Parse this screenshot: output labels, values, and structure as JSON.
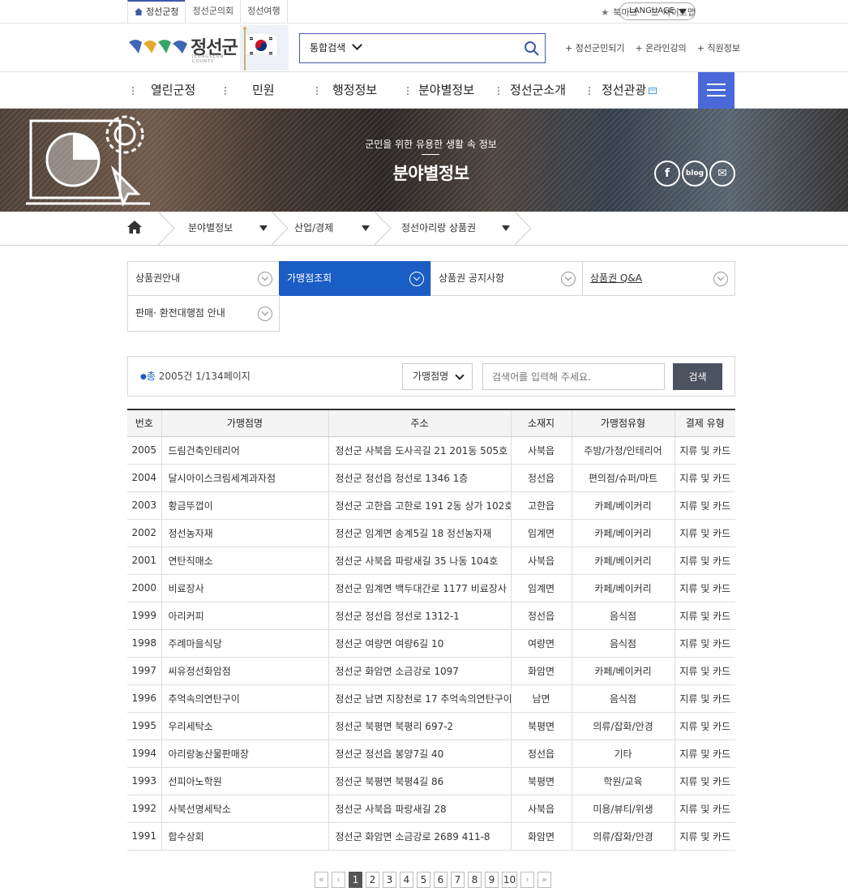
{
  "util": {
    "tabs": [
      "정선군청",
      "정선군의회",
      "정선여행"
    ],
    "bookmark": "북마크",
    "sitemap": "사이트맵",
    "language": "LANGUAGE"
  },
  "header": {
    "logo_text": "정선군",
    "logo_sub": "JEONGSEON COUNTY",
    "search_scope": "통합검색",
    "links": [
      "+ 정선군민되기",
      "+ 온라인강의",
      "+ 직원정보"
    ]
  },
  "gnb": [
    "열린군정",
    "민원",
    "행정정보",
    "분야별정보",
    "정선군소개",
    "정선관광"
  ],
  "banner": {
    "subtitle": "군민을 위한 유용한 생활 속 정보",
    "title": "분야별정보",
    "sns": [
      "f",
      "blog",
      "✉"
    ]
  },
  "location": [
    "분야별정보",
    "산업/경제",
    "정선아리랑 상품권"
  ],
  "subtabs": [
    "상품권안내",
    "가맹점조회",
    "상품권 공지사항",
    "상품권 Q&A",
    "판매· 환전대행점 안내"
  ],
  "search": {
    "count_prefix": "총",
    "count_text": " 2005건 1/134페이지",
    "select_value": "가맹점명",
    "placeholder": "검색어를 입력해 주세요.",
    "button": "검색"
  },
  "table": {
    "headers": [
      "번호",
      "가맹점명",
      "주소",
      "소재지",
      "가맹점유형",
      "결제 유형"
    ],
    "rows": [
      [
        "2005",
        "드림건축인테리어",
        "정선군 사북읍 도사곡길 21 201동 505호",
        "사북읍",
        "주방/가정/인테리어",
        "지류 및 카드"
      ],
      [
        "2004",
        "달시아이스크림세계과자점",
        "정선군 정선읍 정선로 1346 1층",
        "정선읍",
        "편의점/슈퍼/마트",
        "지류 및 카드"
      ],
      [
        "2003",
        "황금뚜껍이",
        "정선군 고한읍 고한로 191 2동 상가 102호",
        "고한읍",
        "카페/베이커리",
        "지류 및 카드"
      ],
      [
        "2002",
        "정선농자재",
        "정선군 임계면 송계5길 18 정선농자재",
        "임계면",
        "카페/베이커리",
        "지류 및 카드"
      ],
      [
        "2001",
        "연탄직매소",
        "정선군 사북읍 파랑새길 35 나동 104호",
        "사북읍",
        "카페/베이커리",
        "지류 및 카드"
      ],
      [
        "2000",
        "비료장사",
        "정선군 임계면 백두대간로 1177 비료장사",
        "임계면",
        "카페/베이커리",
        "지류 및 카드"
      ],
      [
        "1999",
        "아리커피",
        "정선군 정선읍 정선로 1312-1",
        "정선읍",
        "음식점",
        "지류 및 카드"
      ],
      [
        "1998",
        "주례마을식당",
        "정선군 여량면 여량6길 10",
        "여량면",
        "음식점",
        "지류 및 카드"
      ],
      [
        "1997",
        "씨유정선화암점",
        "정선군 화암면 소금강로 1097",
        "화암면",
        "카페/베이커리",
        "지류 및 카드"
      ],
      [
        "1996",
        "추억속의연탄구이",
        "정선군 남면 지장천로 17 추억속의연탄구이",
        "남면",
        "음식점",
        "지류 및 카드"
      ],
      [
        "1995",
        "우리세탁소",
        "정선군 북평면 북평리 697-2",
        "북평면",
        "의류/잡화/안경",
        "지류 및 카드"
      ],
      [
        "1994",
        "아리랑농산물판매장",
        "정선군 정선읍 봉양7길 40",
        "정선읍",
        "기타",
        "지류 및 카드"
      ],
      [
        "1993",
        "선피아노학원",
        "정선군 북평면 북평4길 86",
        "북평면",
        "학원/교육",
        "지류 및 카드"
      ],
      [
        "1992",
        "사북선명세탁소",
        "정선군 사북읍 파랑새길 28",
        "사북읍",
        "미용/뷰티/위생",
        "지류 및 카드"
      ],
      [
        "1991",
        "합수상회",
        "정선군 화암면 소금강로 2689 411-8",
        "화암면",
        "의류/잡화/안경",
        "지류 및 카드"
      ]
    ]
  },
  "pager": {
    "first": "«",
    "prev": "‹",
    "pages": [
      "1",
      "2",
      "3",
      "4",
      "5",
      "6",
      "7",
      "8",
      "9",
      "10"
    ],
    "current": "1",
    "next": "›",
    "last": "»"
  },
  "colors": {
    "accent": "#1a5dc4",
    "menu_button": "#4a68d8",
    "search_button": "#4b5260"
  }
}
